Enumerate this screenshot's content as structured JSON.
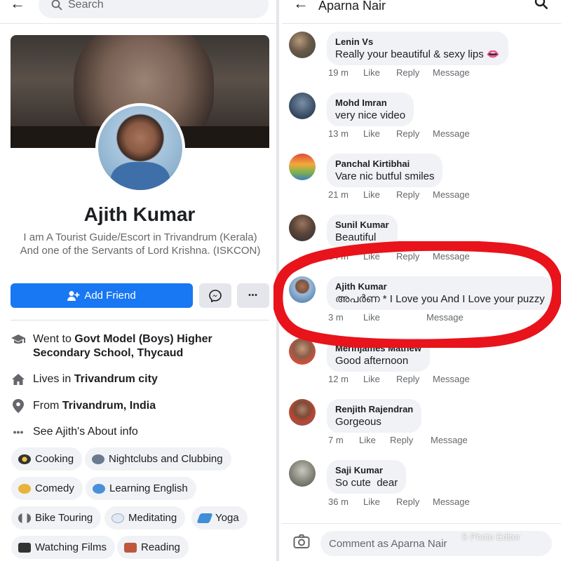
{
  "profile": {
    "search_placeholder": "Search",
    "name": "Ajith Kumar",
    "bio": "I am A Tourist Guide/Escort in Trivandrum (Kerala) And one of the Servants of Lord Krishna. (ISKCON)",
    "add_friend_label": "Add Friend",
    "more_label": "•••",
    "education_prefix": "Went to ",
    "education_school": "Govt Model (Boys) Higher Secondary School, Thycaud",
    "lives_prefix": "Lives in ",
    "lives_place": "Trivandrum city",
    "from_prefix": "From ",
    "from_place": "Trivandrum, India",
    "about_link": "See Ajith's About info",
    "interests": [
      "Cooking",
      "Nightclubs and Clubbing",
      "Comedy",
      "Learning English",
      "Bike Touring",
      "Meditating",
      "Yoga",
      "Watching Films",
      "Reading"
    ]
  },
  "comments_header": {
    "title": "Aparna Nair"
  },
  "actions": {
    "like": "Like",
    "reply": "Reply",
    "message": "Message"
  },
  "comments": [
    {
      "author": "Lenin Vs",
      "text": "Really your beautiful & sexy lips 👄",
      "time": "19 m"
    },
    {
      "author": "Mohd Imran",
      "text": "very nice video",
      "time": "13 m"
    },
    {
      "author": "Panchal Kirtibhai",
      "text": "Vare nic butful smiles",
      "time": "21 m"
    },
    {
      "author": "Sunil Kumar",
      "text": "Beautiful",
      "time": "34 m"
    },
    {
      "author": "Ajith Kumar",
      "text": "അപർണ * I Love you And I Love your puzzy",
      "time": "3 m"
    },
    {
      "author": "Merinjames Mathew",
      "text": "Good afternoon",
      "time": "12 m"
    },
    {
      "author": "Renjith Rajendran",
      "text": "Gorgeous",
      "time": "7 m"
    },
    {
      "author": "Saji Kumar",
      "text": "So cute  dear",
      "time": "36 m"
    }
  ],
  "composer": {
    "placeholder": "Comment as Aparna Nair"
  },
  "watermark": "S Photo Editor",
  "colors": {
    "facebook_blue": "#1877f2",
    "bubble_gray": "#f0f2f5",
    "highlight_red": "#e8131b"
  }
}
